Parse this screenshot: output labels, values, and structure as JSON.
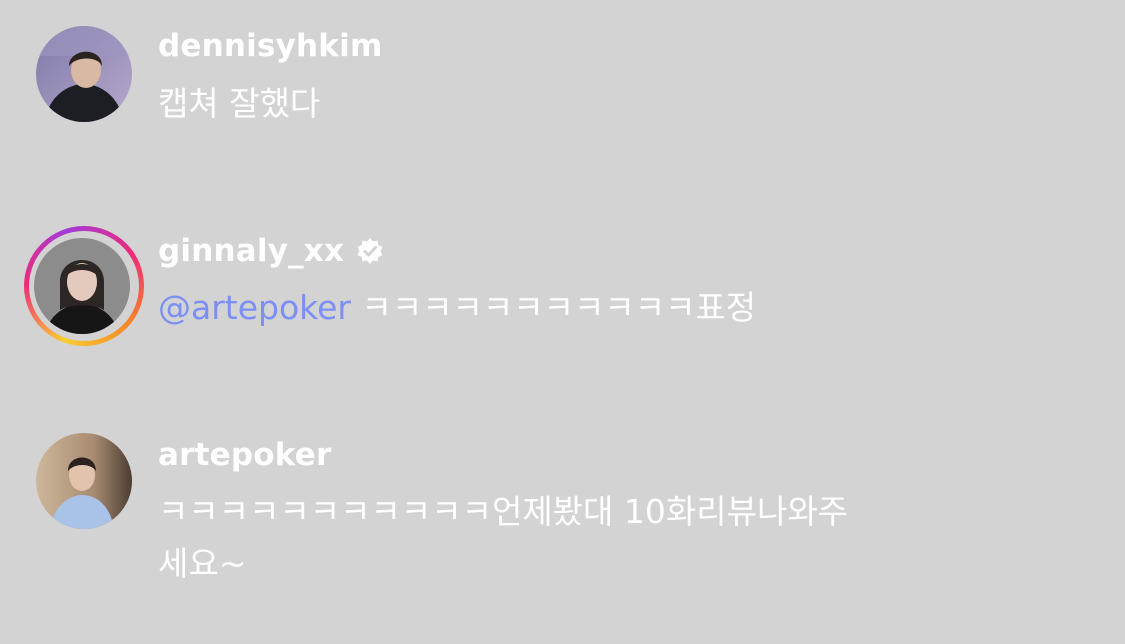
{
  "colors": {
    "background": "#d3d3d3",
    "text": "#ffffff",
    "mention": "#7b8ff5"
  },
  "comments": [
    {
      "username": "dennisyhkim",
      "verified": false,
      "has_story_ring": false,
      "lines": [
        "캡쳐 잘했다"
      ]
    },
    {
      "username": "ginnaly_xx",
      "verified": true,
      "verified_icon": "verified-badge-icon",
      "has_story_ring": true,
      "mention": "@artepoker",
      "text": " ㅋㅋㅋㅋㅋㅋㅋㅋㅋㅋㅋ표정"
    },
    {
      "username": "artepoker",
      "verified": false,
      "has_story_ring": false,
      "lines": [
        "ㅋㅋㅋㅋㅋㅋㅋㅋㅋㅋㅋ언제봤대 10화리뷰나와주",
        "세요~"
      ]
    }
  ]
}
